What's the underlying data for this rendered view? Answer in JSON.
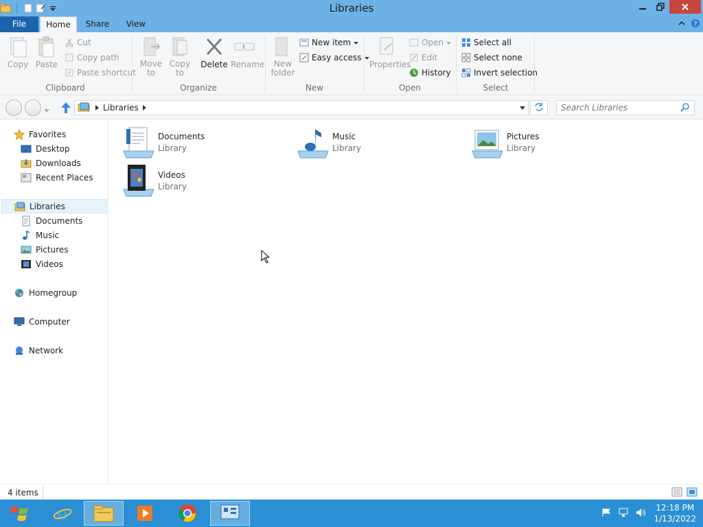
{
  "window": {
    "title": "Libraries"
  },
  "ribbon": {
    "tabs": [
      {
        "label": "File"
      },
      {
        "label": "Home"
      },
      {
        "label": "Share"
      },
      {
        "label": "View"
      }
    ],
    "clipboard": {
      "copy": "Copy",
      "paste": "Paste",
      "cut": "Cut",
      "copy_path": "Copy path",
      "paste_shortcut": "Paste shortcut",
      "group_name": "Clipboard"
    },
    "organize": {
      "move_to": "Move\nto",
      "copy_to": "Copy\nto",
      "delete": "Delete",
      "rename": "Rename",
      "group_name": "Organize"
    },
    "new": {
      "new_folder": "New\nfolder",
      "new_item": "New item",
      "easy_access": "Easy access",
      "group_name": "New"
    },
    "open": {
      "properties": "Properties",
      "open": "Open",
      "edit": "Edit",
      "history": "History",
      "group_name": "Open"
    },
    "select": {
      "select_all": "Select all",
      "select_none": "Select none",
      "invert_selection": "Invert selection",
      "group_name": "Select"
    }
  },
  "address": {
    "path": "Libraries",
    "search_placeholder": "Search Libraries"
  },
  "navpane": {
    "favorites": "Favorites",
    "desktop": "Desktop",
    "downloads": "Downloads",
    "recent_places": "Recent Places",
    "libraries": "Libraries",
    "documents": "Documents",
    "music": "Music",
    "pictures": "Pictures",
    "videos": "Videos",
    "homegroup": "Homegroup",
    "computer": "Computer",
    "network": "Network"
  },
  "content": {
    "items": [
      {
        "name": "Documents",
        "type": "Library"
      },
      {
        "name": "Music",
        "type": "Library"
      },
      {
        "name": "Pictures",
        "type": "Library"
      },
      {
        "name": "Videos",
        "type": "Library"
      }
    ]
  },
  "status": {
    "count": "4 items"
  },
  "taskbar": {
    "time": "12:18 PM",
    "date": "1/13/2022"
  }
}
